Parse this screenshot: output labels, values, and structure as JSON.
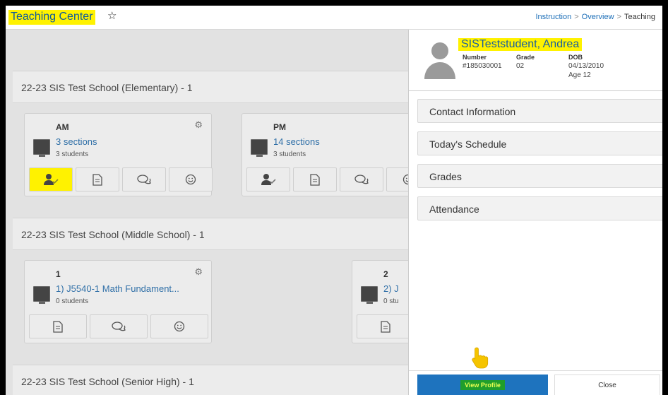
{
  "header": {
    "title": "Teaching Center",
    "star_icon": "star-outline-icon",
    "breadcrumb": [
      "Instruction",
      "Overview",
      "Teaching"
    ]
  },
  "schools": [
    {
      "name": "22-23 SIS Test School (Elementary) - 1",
      "cards": [
        {
          "period": "AM",
          "sections": "3 sections",
          "students": "3 students",
          "actions": [
            "attendance-icon",
            "document-icon",
            "chat-icon",
            "smiley-icon"
          ]
        },
        {
          "period": "PM",
          "sections": "14 sections",
          "students": "3 students",
          "actions": [
            "attendance-icon",
            "document-icon",
            "chat-icon",
            "smiley-icon"
          ]
        }
      ]
    },
    {
      "name": "22-23 SIS Test School (Middle School) - 1",
      "cards": [
        {
          "period": "1",
          "sections": "1) J5540-1 Math Fundament...",
          "students": "0 students",
          "actions": [
            "document-icon",
            "chat-icon",
            "smiley-icon"
          ]
        },
        {
          "period": "2",
          "sections": "2) J",
          "students": "0 stu",
          "actions": [
            "document-icon"
          ]
        }
      ]
    },
    {
      "name": "22-23 SIS Test School (Senior High) - 1",
      "cards": []
    }
  ],
  "panel": {
    "student_name": "SISTeststudent, Andrea",
    "fields": [
      {
        "label": "Number",
        "value": "#185030001"
      },
      {
        "label": "Grade",
        "value": "02"
      },
      {
        "label": "DOB",
        "value": "04/13/2010",
        "extra": "Age 12"
      }
    ],
    "sections": [
      "Contact Information",
      "Today's Schedule",
      "Grades",
      "Attendance"
    ],
    "view_profile_label": "View Profile",
    "close_label": "Close"
  },
  "colors": {
    "highlight": "#fff200",
    "primary": "#1e73be",
    "link": "#1d6fb8"
  }
}
